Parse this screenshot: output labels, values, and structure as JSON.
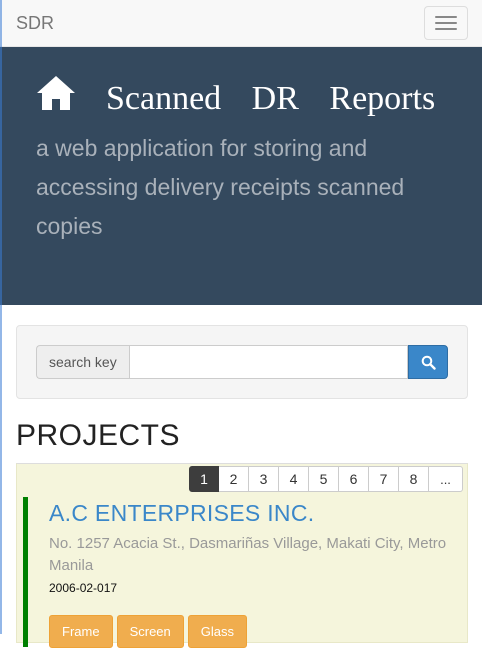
{
  "navbar": {
    "brand": "SDR"
  },
  "jumbotron": {
    "title": "Scanned DR Reports",
    "subtitle": "a web application for storing and accessing delivery receipts scanned copies"
  },
  "search": {
    "addon_label": "search key",
    "value": "",
    "placeholder": ""
  },
  "projects": {
    "heading": "PROJECTS",
    "pages": [
      "1",
      "2",
      "3",
      "4",
      "5",
      "6",
      "7",
      "8",
      "..."
    ],
    "active_page": "1",
    "items": [
      {
        "name": "A.C ENTERPRISES INC.",
        "address": "No. 1257 Acacia St., Dasmariñas Village, Makati City, Metro Manila",
        "code": "2006-02-017",
        "tags": [
          "Frame",
          "Screen",
          "Glass"
        ]
      }
    ]
  },
  "colors": {
    "jumbotron_bg": "#34495e",
    "accent_blue": "#3a87c9",
    "project_border": "#008000",
    "tag_bg": "#f0ad4e"
  }
}
